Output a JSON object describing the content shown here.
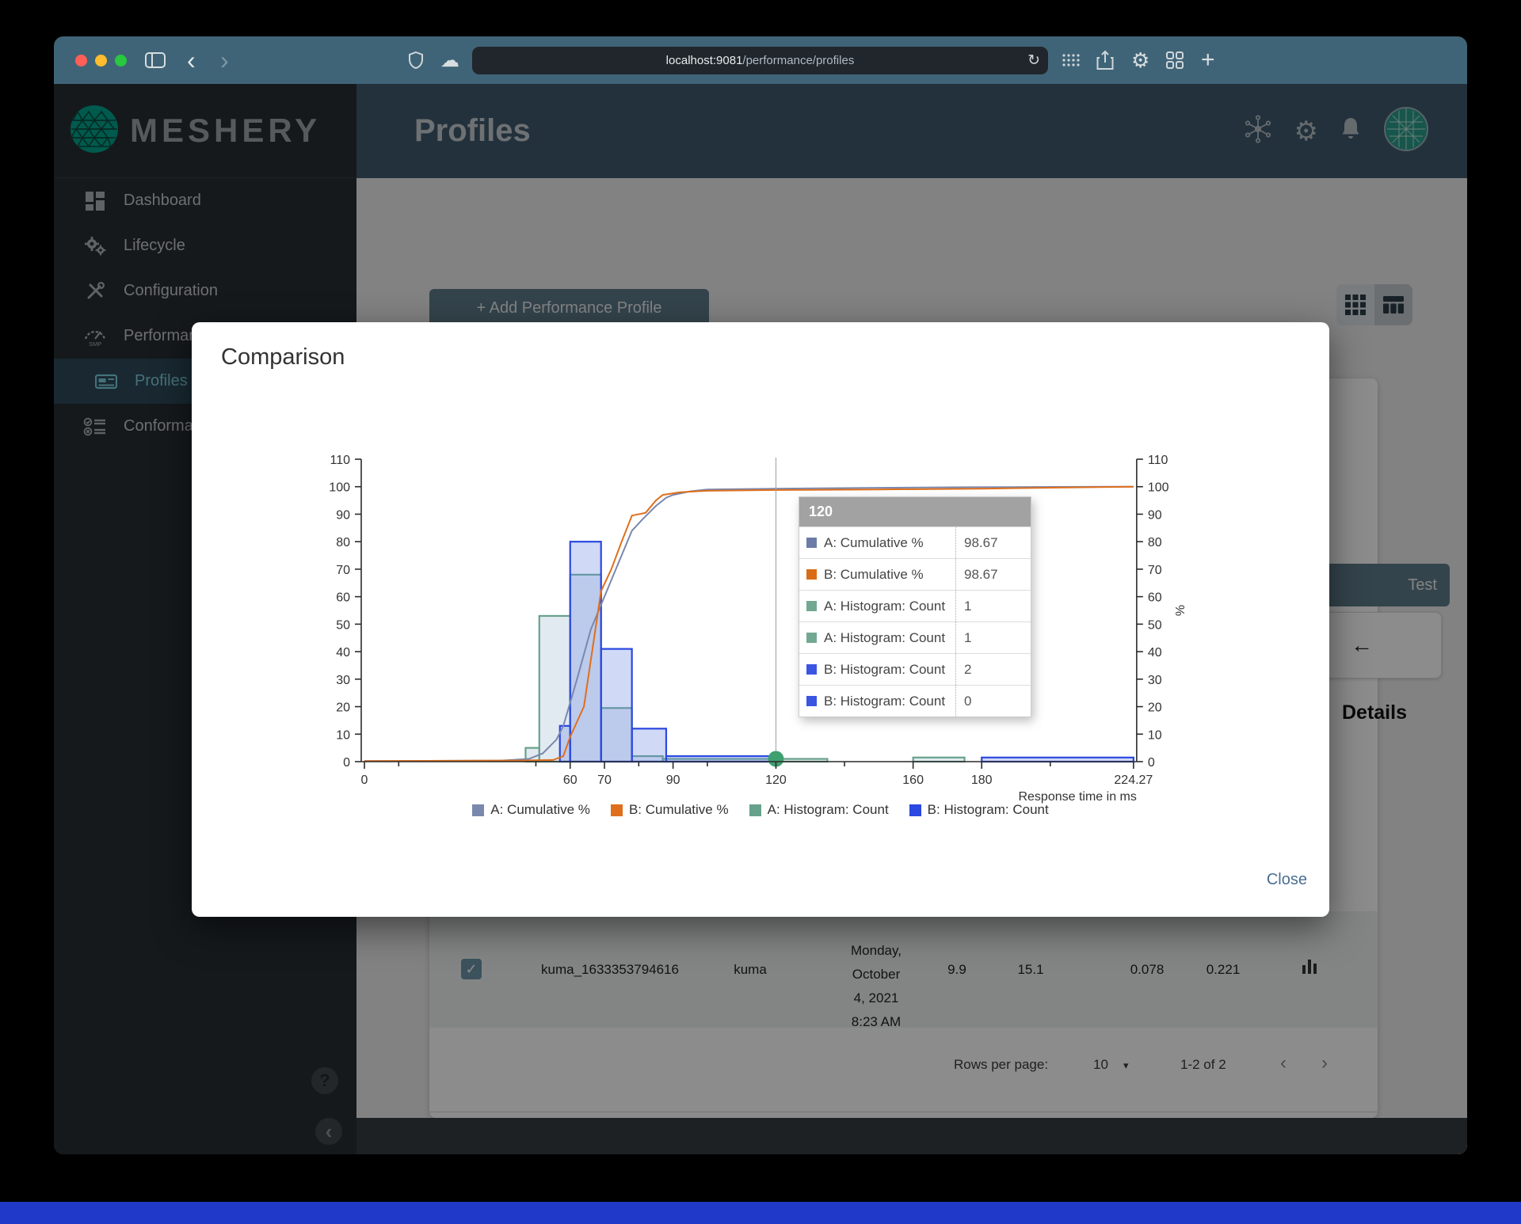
{
  "browser": {
    "url_host": "localhost:9081",
    "url_path": "/performance/profiles",
    "traffic_lights": [
      "#ff5f57",
      "#febc2e",
      "#28c840"
    ],
    "reload_glyph": "↻",
    "back_glyph": "‹",
    "forward_glyph": "›",
    "plus_glyph": "+",
    "cloud_glyph": "☁",
    "gear_glyph": "⚙"
  },
  "sidebar": {
    "brand": "MESHERY",
    "items": [
      {
        "label": "Dashboard"
      },
      {
        "label": "Lifecycle"
      },
      {
        "label": "Configuration"
      },
      {
        "label": "Performance"
      },
      {
        "label": "Profiles"
      },
      {
        "label": "Conformance"
      }
    ],
    "performance_icon_caption": "SMP",
    "help_label": "?",
    "collapse_glyph": "‹"
  },
  "header": {
    "title": "Profiles",
    "gear_glyph": "⚙"
  },
  "content": {
    "add_profile_button": "+ Add Performance Profile",
    "test_button": "Test",
    "back_arrow": "←",
    "details_heading": "Details",
    "row": {
      "checkbox_glyph": "✓",
      "name": "kuma_1633353794616",
      "mesh": "kuma",
      "date_lines": [
        "Monday,",
        "October",
        "4, 2021",
        "8:23 AM"
      ],
      "qps": "9.9",
      "duration": "15.1",
      "p50": "0.078",
      "p99": "0.221"
    },
    "pagination": {
      "label": "Rows per page:",
      "per_page": "10",
      "caret": "▾",
      "range": "1-2 of 2",
      "prev": "‹",
      "next": "›"
    }
  },
  "modal": {
    "title": "Comparison",
    "close_button": "Close",
    "tooltip": {
      "header": "120",
      "rows": [
        {
          "color": "#6b7da6",
          "label": "A: Cumulative %",
          "value": "98.67"
        },
        {
          "color": "#d96c15",
          "label": "B: Cumulative %",
          "value": "98.67"
        },
        {
          "color": "#72a891",
          "label": "A: Histogram: Count",
          "value": "1"
        },
        {
          "color": "#72a891",
          "label": "A: Histogram: Count",
          "value": "1"
        },
        {
          "color": "#3b55e3",
          "label": "B: Histogram: Count",
          "value": "2"
        },
        {
          "color": "#3b55e3",
          "label": "B: Histogram: Count",
          "value": "0"
        }
      ]
    },
    "legend": [
      {
        "color": "#7a88ad",
        "label": "A: Cumulative %"
      },
      {
        "color": "#df6f1c",
        "label": "B: Cumulative %"
      },
      {
        "color": "#68a18b",
        "label": "A: Histogram: Count"
      },
      {
        "color": "#2b48e0",
        "label": "B: Histogram: Count"
      }
    ]
  },
  "chart_data": {
    "type": "combo histogram bars + cumulative percent lines",
    "x_label": "Response time in ms",
    "y_right_label": "%",
    "x_range": [
      0,
      224.27
    ],
    "y_range": [
      0,
      110
    ],
    "x_ticks_labeled": [
      0,
      60,
      70,
      90,
      120,
      160,
      180,
      224.27
    ],
    "x_ticks_minor": [
      10,
      50,
      80,
      100,
      140,
      200
    ],
    "y_ticks": [
      0,
      10,
      20,
      30,
      40,
      50,
      60,
      70,
      80,
      90,
      100,
      110
    ],
    "crosshair_x": 120,
    "selected_point": {
      "x": 120,
      "y": 1,
      "color": "#3ea06f"
    },
    "series": [
      {
        "name": "A: Cumulative %",
        "type": "line",
        "color": "#7a88ad",
        "points": [
          [
            0,
            0.2
          ],
          [
            40,
            0.4
          ],
          [
            48,
            1
          ],
          [
            52,
            3
          ],
          [
            56,
            8
          ],
          [
            58,
            13
          ],
          [
            62,
            30
          ],
          [
            66,
            48
          ],
          [
            70,
            60
          ],
          [
            74,
            72
          ],
          [
            78,
            84
          ],
          [
            81,
            88
          ],
          [
            85,
            93
          ],
          [
            88,
            96
          ],
          [
            90,
            97
          ],
          [
            95,
            98.3
          ],
          [
            100,
            99
          ],
          [
            120,
            99.3
          ],
          [
            150,
            99.6
          ],
          [
            175,
            99.8
          ],
          [
            224.27,
            100
          ]
        ]
      },
      {
        "name": "B: Cumulative %",
        "type": "line",
        "color": "#df6f1c",
        "points": [
          [
            0,
            0.2
          ],
          [
            45,
            0.4
          ],
          [
            55,
            0.6
          ],
          [
            58,
            2
          ],
          [
            60,
            9
          ],
          [
            64,
            20
          ],
          [
            67,
            45
          ],
          [
            69,
            62
          ],
          [
            72,
            70
          ],
          [
            75,
            80
          ],
          [
            78,
            89.5
          ],
          [
            82,
            90.5
          ],
          [
            85,
            95
          ],
          [
            87,
            97
          ],
          [
            92,
            98
          ],
          [
            100,
            98.5
          ],
          [
            120,
            98.8
          ],
          [
            150,
            99
          ],
          [
            180,
            99.3
          ],
          [
            205,
            99.7
          ],
          [
            224.27,
            100
          ]
        ]
      },
      {
        "name": "A: Histogram: Count",
        "type": "histogram",
        "color": "#68a18b",
        "fill": "rgba(150,180,205,0.28)",
        "bins": [
          [
            47,
            51,
            5
          ],
          [
            51,
            60,
            53
          ],
          [
            60,
            69,
            68
          ],
          [
            69,
            78,
            19.5
          ],
          [
            78,
            87,
            2
          ],
          [
            87,
            120,
            1
          ],
          [
            120,
            135,
            1
          ],
          [
            160,
            175,
            1.5
          ]
        ]
      },
      {
        "name": "B: Histogram: Count",
        "type": "histogram",
        "color": "#2b48e0",
        "fill": "rgba(100,130,225,0.30)",
        "bins": [
          [
            57,
            60,
            13
          ],
          [
            60,
            69,
            80
          ],
          [
            69,
            78,
            41
          ],
          [
            78,
            88,
            12
          ],
          [
            88,
            120,
            2
          ],
          [
            180,
            224.27,
            1.5
          ]
        ]
      }
    ],
    "tooltip_at_x_120": {
      "A_cumulative_pct": 98.67,
      "B_cumulative_pct": 98.67,
      "A_histogram_counts": [
        1,
        1
      ],
      "B_histogram_counts": [
        2,
        0
      ]
    }
  }
}
